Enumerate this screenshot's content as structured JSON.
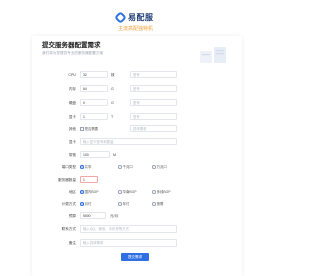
{
  "header": {
    "logo_text": "易配服",
    "subtitle": "主流高配独特机"
  },
  "form": {
    "title": "提交服务器配置需求",
    "description": "我们将为您提供专业的服务器配置方案",
    "fields": {
      "cpu": {
        "label": "CPU",
        "value": "32",
        "unit": "核",
        "extra_placeholder": "型号"
      },
      "memory": {
        "label": "内存",
        "value": "64",
        "unit": "G",
        "extra_placeholder": "型号"
      },
      "disk": {
        "label": "硬盘",
        "value": "0",
        "unit": "G",
        "extra_placeholder": "型号"
      },
      "gpu": {
        "label": "显卡",
        "value": "1",
        "unit": "T",
        "extra_placeholder": "型号"
      },
      "other": {
        "label": "其他",
        "checkbox_label": "是否需要",
        "extra_placeholder": "具体需求"
      },
      "gpu_card": {
        "label": "显卡",
        "placeholder": "输入显卡型号和数量"
      },
      "bandwidth": {
        "label": "带宽",
        "value": "100",
        "unit": "M"
      },
      "port_type": {
        "label": "端口类型",
        "options": [
          "共享",
          "千兆口",
          "万兆口"
        ],
        "selected": "共享"
      },
      "server_count": {
        "label": "服务器数量",
        "value": "1"
      },
      "region": {
        "label": "地区",
        "options": [
          "国内BGP",
          "华南BGP",
          "多线BGP"
        ],
        "selected": "国内BGP"
      },
      "billing": {
        "label": "计费方式",
        "options": [
          "月付",
          "年付",
          "按需"
        ],
        "selected": "月付"
      },
      "budget": {
        "label": "预算",
        "value": "5000",
        "unit": "元/月"
      },
      "contact": {
        "label": "联系方式",
        "placeholder": "输入QQ、微信、手机号等方式"
      },
      "notes": {
        "label": "备注",
        "placeholder": "输入具体需求"
      }
    },
    "submit_label": "提交需求"
  }
}
